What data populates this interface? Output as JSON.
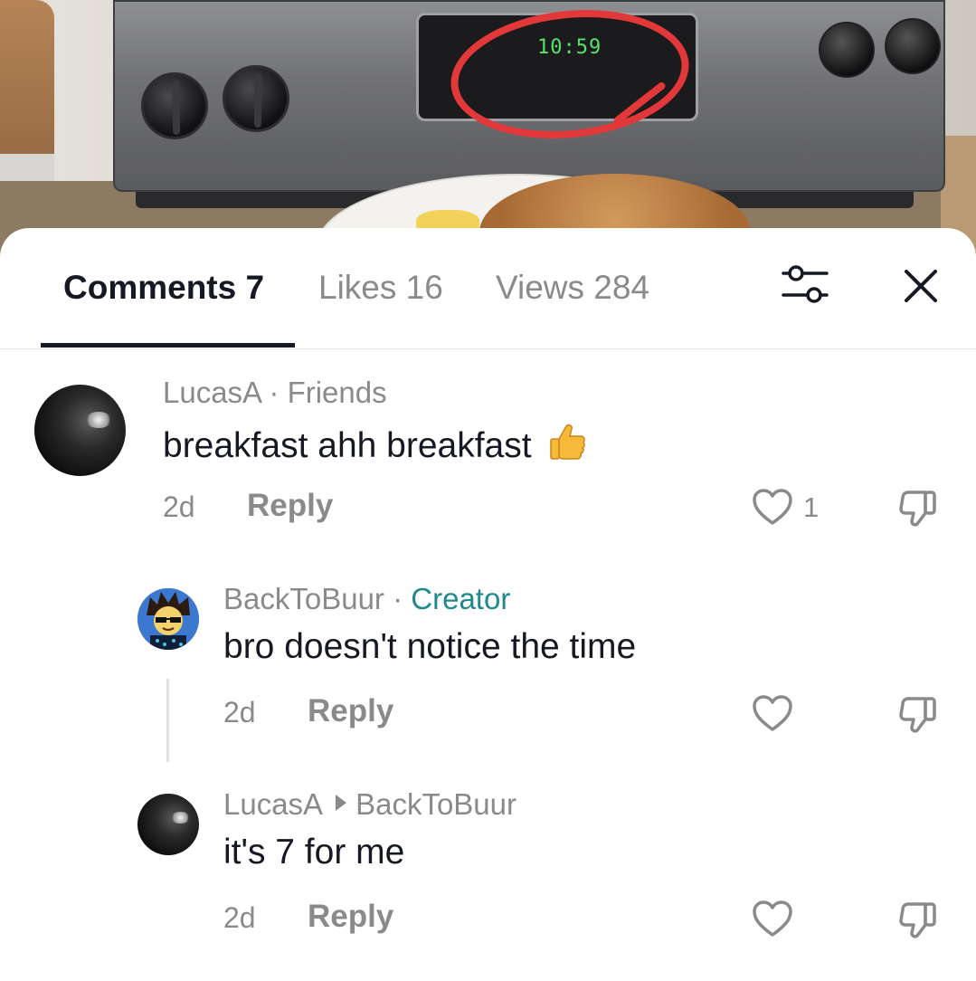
{
  "video": {
    "stove_display_time": "10:59"
  },
  "tabs": [
    {
      "label": "Comments 7",
      "active": true
    },
    {
      "label": "Likes 16",
      "active": false
    },
    {
      "label": "Views 284",
      "active": false
    }
  ],
  "icons": {
    "filter": "sliders-icon",
    "close": "close-icon",
    "like": "heart-icon",
    "dislike": "thumbs-down-icon",
    "emoji": "thumbs-up-emoji"
  },
  "colors": {
    "accent_creator": "#1f8a8e",
    "secondary_text": "#8a8a8a",
    "primary_text": "#161823",
    "highlight_circle": "#e2383a"
  },
  "comments": [
    {
      "author": "LucasA",
      "tag": "Friends",
      "text": "breakfast ahh breakfast",
      "emoji": "👍",
      "age": "2d",
      "reply_label": "Reply",
      "likes": "1"
    },
    {
      "author": "BackToBuur",
      "tag": "Creator",
      "text": "bro doesn't notice the time",
      "age": "2d",
      "reply_label": "Reply",
      "likes": ""
    },
    {
      "author": "LucasA",
      "reply_to": "BackToBuur",
      "text": "it's 7 for me",
      "age": "2d",
      "reply_label": "Reply",
      "likes": ""
    }
  ]
}
